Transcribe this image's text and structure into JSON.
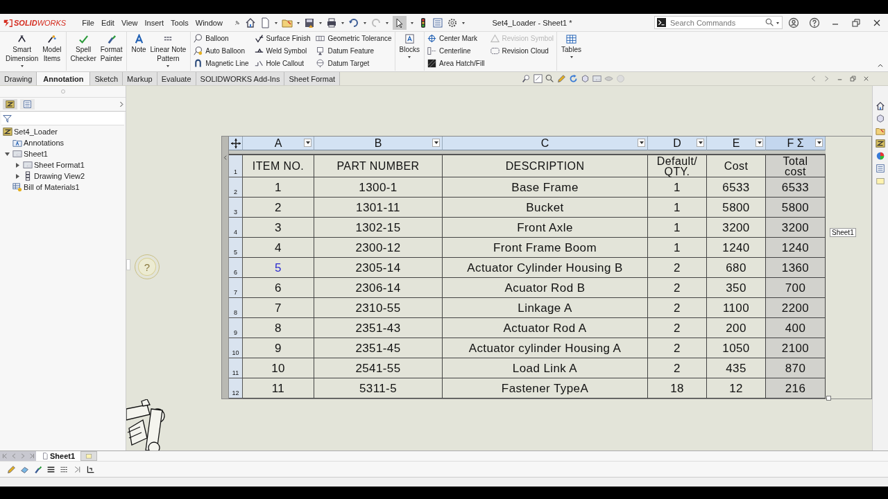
{
  "app": {
    "logo": "**SOLID**WORKS",
    "menu": [
      "File",
      "Edit",
      "View",
      "Insert",
      "Tools",
      "Window"
    ],
    "title": "Set4_Loader - Sheet1 *",
    "search": {
      "placeholder": "Search Commands"
    }
  },
  "ribbon": [
    {
      "kind": "large",
      "items": [
        {
          "label": "Smart\nDimension",
          "dropdown": true
        },
        {
          "label": "Model\nItems",
          "dropdown": false
        }
      ]
    },
    {
      "kind": "large",
      "items": [
        {
          "label": "Spell\nChecker",
          "dropdown": false
        },
        {
          "label": "Format\nPainter",
          "dropdown": false
        }
      ]
    },
    {
      "kind": "large",
      "items": [
        {
          "label": "Note",
          "dropdown": false
        },
        {
          "label": "Linear Note\nPattern",
          "dropdown": true
        }
      ]
    },
    {
      "kind": "stack",
      "items": [
        {
          "label": "Balloon",
          "disabled": false
        },
        {
          "label": "Auto Balloon",
          "disabled": false
        },
        {
          "label": "Magnetic Line",
          "disabled": false
        }
      ]
    },
    {
      "kind": "stack",
      "items": [
        {
          "label": "Surface Finish",
          "disabled": false
        },
        {
          "label": "Weld Symbol",
          "disabled": false
        },
        {
          "label": "Hole Callout",
          "disabled": false
        }
      ]
    },
    {
      "kind": "stack",
      "items": [
        {
          "label": "Geometric Tolerance",
          "disabled": false
        },
        {
          "label": "Datum Feature",
          "disabled": false
        },
        {
          "label": "Datum Target",
          "disabled": false
        }
      ]
    },
    {
      "kind": "large",
      "items": [
        {
          "label": "Blocks",
          "dropdown": true
        }
      ]
    },
    {
      "kind": "stack",
      "items": [
        {
          "label": "Center Mark",
          "disabled": false
        },
        {
          "label": "Centerline",
          "disabled": false
        },
        {
          "label": "Area Hatch/Fill",
          "disabled": false
        }
      ]
    },
    {
      "kind": "stack",
      "items": [
        {
          "label": "Revision Symbol",
          "disabled": true
        },
        {
          "label": "Revision Cloud",
          "disabled": false
        }
      ]
    },
    {
      "kind": "large",
      "items": [
        {
          "label": "Tables",
          "dropdown": true
        }
      ]
    }
  ],
  "tabs": [
    {
      "label": "Drawing",
      "selected": false
    },
    {
      "label": "Annotation",
      "selected": true
    },
    {
      "label": "Sketch",
      "selected": false
    },
    {
      "label": "Markup",
      "selected": false
    },
    {
      "label": "Evaluate",
      "selected": false
    },
    {
      "label": "SOLIDWORKS Add-Ins",
      "selected": false
    },
    {
      "label": "Sheet Format",
      "selected": false
    }
  ],
  "tree": {
    "label": "Set4_Loader",
    "children": [
      {
        "label": "Annotations"
      },
      {
        "label": "Sheet1",
        "expanded": true,
        "children": [
          {
            "label": "Sheet Format1",
            "expanded": false
          },
          {
            "label": "Drawing View2",
            "expanded": false
          }
        ]
      },
      {
        "label": "Bill of Materials1"
      }
    ]
  },
  "table": {
    "columns": [
      {
        "label": "A",
        "selected": false
      },
      {
        "label": "B",
        "selected": false
      },
      {
        "label": "C",
        "selected": false
      },
      {
        "label": "D",
        "selected": false
      },
      {
        "label": "E",
        "selected": false
      },
      {
        "label": "F Σ",
        "selected": true
      }
    ],
    "rows": [
      {
        "number": "1",
        "active": false,
        "cells": [
          "ITEM NO.",
          "PART NUMBER",
          "DESCRIPTION",
          "Default/\nQTY.",
          "Cost",
          "Total\ncost"
        ]
      },
      {
        "number": "2",
        "active": false,
        "cells": [
          "1",
          "1300-1",
          "Base Frame",
          "1",
          "6533",
          "6533"
        ]
      },
      {
        "number": "3",
        "active": false,
        "cells": [
          "2",
          "1301-11",
          "Bucket",
          "1",
          "5800",
          "5800"
        ]
      },
      {
        "number": "4",
        "active": false,
        "cells": [
          "3",
          "1302-15",
          "Front Axle",
          "1",
          "3200",
          "3200"
        ]
      },
      {
        "number": "5",
        "active": false,
        "cells": [
          "4",
          "2300-12",
          "Front Frame Boom",
          "1",
          "1240",
          "1240"
        ]
      },
      {
        "number": "6",
        "active": true,
        "cells": [
          "5",
          "2305-14",
          "Actuator Cylinder Housing B",
          "2",
          "680",
          "1360"
        ]
      },
      {
        "number": "7",
        "active": false,
        "cells": [
          "6",
          "2306-14",
          "Acuator Rod B",
          "2",
          "350",
          "700"
        ]
      },
      {
        "number": "8",
        "active": false,
        "cells": [
          "7",
          "2310-55",
          "Linkage A",
          "2",
          "1100",
          "2200"
        ]
      },
      {
        "number": "9",
        "active": false,
        "cells": [
          "8",
          "2351-43",
          "Actuator Rod A",
          "2",
          "200",
          "400"
        ]
      },
      {
        "number": "10",
        "active": false,
        "cells": [
          "9",
          "2351-45",
          "Actuator cylinder Housing A",
          "2",
          "1050",
          "2100"
        ]
      },
      {
        "number": "11",
        "active": false,
        "cells": [
          "10",
          "2541-55",
          "Load Link A",
          "2",
          "435",
          "870"
        ]
      },
      {
        "number": "12",
        "active": false,
        "cells": [
          "11",
          "5311-5",
          "Fastener TypeA",
          "18",
          "12",
          "216"
        ]
      }
    ]
  },
  "tooltip": "Sheet1",
  "help_bubble": "?",
  "sheet_tabs": [
    {
      "label": "Sheet1",
      "selected": true
    }
  ]
}
